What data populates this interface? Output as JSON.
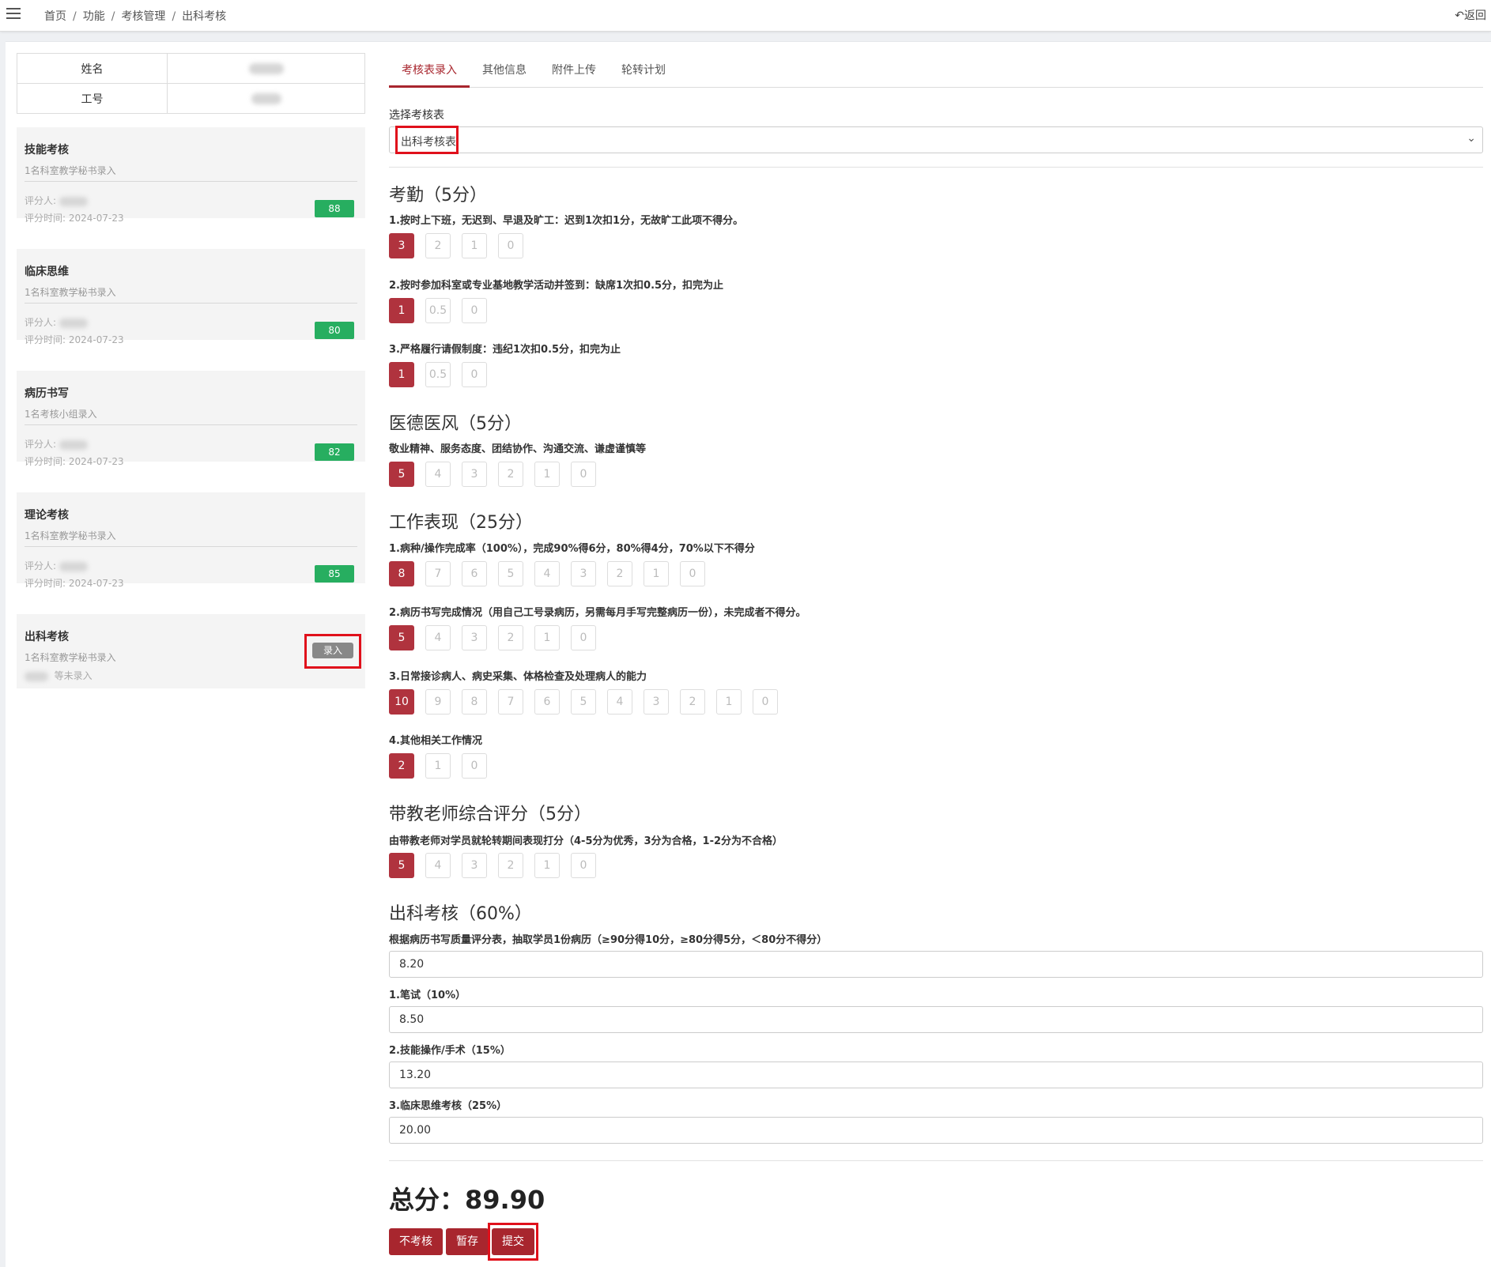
{
  "breadcrumb": [
    "首页",
    "功能",
    "考核管理",
    "出科考核"
  ],
  "back_label": "返回",
  "info": {
    "name_label": "姓名",
    "id_label": "工号"
  },
  "cards": [
    {
      "title": "技能考核",
      "sub": "1名科室教学秘书录入",
      "rater_label": "评分人:",
      "time_label": "评分时间: 2024-07-23",
      "score": "88"
    },
    {
      "title": "临床思维",
      "sub": "1名科室教学秘书录入",
      "rater_label": "评分人:",
      "time_label": "评分时间: 2024-07-23",
      "score": "80"
    },
    {
      "title": "病历书写",
      "sub": "1名考核小组录入",
      "rater_label": "评分人:",
      "time_label": "评分时间: 2024-07-23",
      "score": "82"
    },
    {
      "title": "理论考核",
      "sub": "1名科室教学秘书录入",
      "rater_label": "评分人:",
      "time_label": "评分时间: 2024-07-23",
      "score": "85"
    }
  ],
  "last_card": {
    "title": "出科考核",
    "sub": "1名科室教学秘书录入",
    "pending": "等未录入",
    "button": "录入"
  },
  "tabs": [
    "考核表录入",
    "其他信息",
    "附件上传",
    "轮转计划"
  ],
  "select": {
    "label": "选择考核表",
    "value": "出科考核表"
  },
  "sections": [
    {
      "title": "考勤（5分）",
      "items": [
        {
          "q": "1.按时上下班，无迟到、早退及旷工：迟到1次扣1分，无故旷工此项不得分。",
          "opts": [
            "3",
            "2",
            "1",
            "0"
          ],
          "selected": "3"
        },
        {
          "q": "2.按时参加科室或专业基地教学活动并签到：缺席1次扣0.5分，扣完为止",
          "opts": [
            "1",
            "0.5",
            "0"
          ],
          "selected": "1"
        },
        {
          "q": "3.严格履行请假制度：违纪1次扣0.5分，扣完为止",
          "opts": [
            "1",
            "0.5",
            "0"
          ],
          "selected": "1"
        }
      ]
    },
    {
      "title": "医德医风（5分）",
      "items": [
        {
          "q": "敬业精神、服务态度、团结协作、沟通交流、谦虚谨慎等",
          "opts": [
            "5",
            "4",
            "3",
            "2",
            "1",
            "0"
          ],
          "selected": "5"
        }
      ]
    },
    {
      "title": "工作表现（25分）",
      "items": [
        {
          "q": "1.病种/操作完成率（100%），完成90%得6分，80%得4分，70%以下不得分",
          "opts": [
            "8",
            "7",
            "6",
            "5",
            "4",
            "3",
            "2",
            "1",
            "0"
          ],
          "selected": "8"
        },
        {
          "q": "2.病历书写完成情况（用自己工号录病历，另需每月手写完整病历一份），未完成者不得分。",
          "opts": [
            "5",
            "4",
            "3",
            "2",
            "1",
            "0"
          ],
          "selected": "5"
        },
        {
          "q": "3.日常接诊病人、病史采集、体格检查及处理病人的能力",
          "opts": [
            "10",
            "9",
            "8",
            "7",
            "6",
            "5",
            "4",
            "3",
            "2",
            "1",
            "0"
          ],
          "selected": "10"
        },
        {
          "q": "4.其他相关工作情况",
          "opts": [
            "2",
            "1",
            "0"
          ],
          "selected": "2"
        }
      ]
    },
    {
      "title": "带教老师综合评分（5分）",
      "items": [
        {
          "q": "由带教老师对学员就轮转期间表现打分（4-5分为优秀，3分为合格，1-2分为不合格）",
          "opts": [
            "5",
            "4",
            "3",
            "2",
            "1",
            "0"
          ],
          "selected": "5"
        }
      ]
    }
  ],
  "exam": {
    "title": "出科考核（60%）",
    "fields": [
      {
        "label": "根据病历书写质量评分表，抽取学员1份病历（≥90分得10分，≥80分得5分，＜80分不得分）",
        "value": "8.20"
      },
      {
        "label": "1.笔试（10%）",
        "value": "8.50"
      },
      {
        "label": "2.技能操作/手术（15%）",
        "value": "13.20"
      },
      {
        "label": "3.临床思维考核（25%）",
        "value": "20.00"
      }
    ]
  },
  "total": "总分：89.90",
  "buttons": {
    "skip": "不考核",
    "save": "暂存",
    "submit": "提交"
  },
  "colors": {
    "primary": "#a8262e",
    "selected_option": "#b0333e",
    "score_badge": "#27ae60",
    "highlight": "#e0101b"
  }
}
